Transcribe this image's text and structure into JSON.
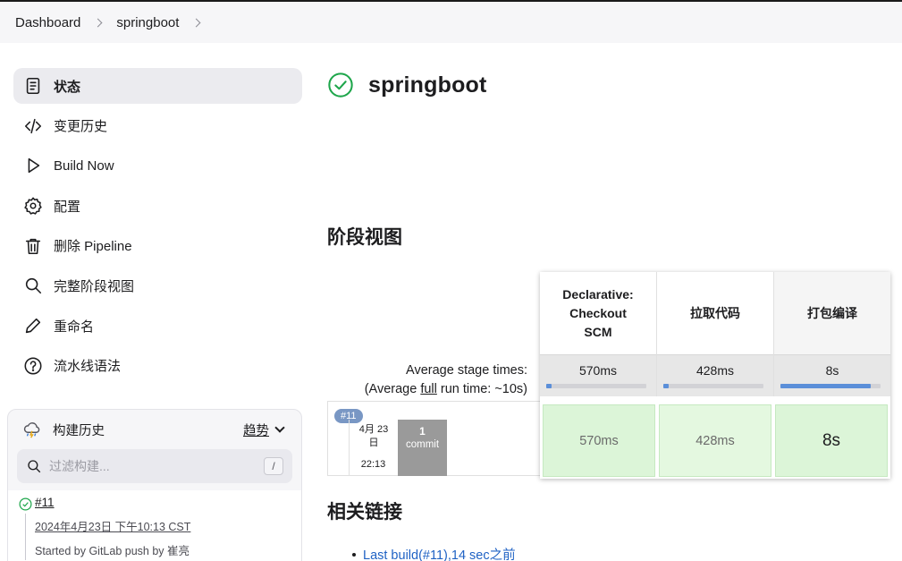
{
  "breadcrumb": [
    "Dashboard",
    "springboot"
  ],
  "sidebar": {
    "items": [
      {
        "label": "状态",
        "icon": "document-icon",
        "active": true
      },
      {
        "label": "变更历史",
        "icon": "code-icon"
      },
      {
        "label": "Build Now",
        "icon": "play-icon"
      },
      {
        "label": "配置",
        "icon": "gear-icon"
      },
      {
        "label": "删除 Pipeline",
        "icon": "trash-icon"
      },
      {
        "label": "完整阶段视图",
        "icon": "search-icon"
      },
      {
        "label": "重命名",
        "icon": "pencil-icon"
      },
      {
        "label": "流水线语法",
        "icon": "help-circle-icon"
      }
    ]
  },
  "history": {
    "title": "构建历史",
    "trend": "趋势",
    "search_placeholder": "过滤构建...",
    "shortcut": "/",
    "builds": [
      {
        "number": "#11",
        "date": "2024年4月23日 下午10:13 CST",
        "started": "Started by GitLab push by 崔亮"
      }
    ]
  },
  "main": {
    "title": "springboot",
    "stage_view_title": "阶段视图",
    "links_title": "相关链接",
    "status_color": "#1ea64b"
  },
  "stage_view": {
    "avg_label": "Average stage times:",
    "avg_run_prefix": "(Average ",
    "avg_run_link": "full",
    "avg_run_suffix": " run time: ~10s)",
    "stages": [
      {
        "name": "Declarative: Checkout SCM",
        "lines": [
          "Declarative:",
          "Checkout",
          "SCM"
        ],
        "avg": "570ms",
        "avg_fraction": 0.05
      },
      {
        "name": "拉取代码",
        "lines": [
          "拉取代码"
        ],
        "avg": "428ms",
        "avg_fraction": 0.05
      },
      {
        "name": "打包编译",
        "lines": [
          "打包编译"
        ],
        "avg": "8s",
        "avg_fraction": 0.9
      }
    ],
    "build": {
      "badge": "#11",
      "date_line1": "4月 23",
      "date_line2": "日",
      "time": "22:13",
      "commit_count": "1",
      "commit_label": "commit",
      "cells": [
        "570ms",
        "428ms",
        "8s"
      ]
    }
  },
  "links": [
    {
      "label": "Last build(#11),14 sec之前"
    }
  ]
}
